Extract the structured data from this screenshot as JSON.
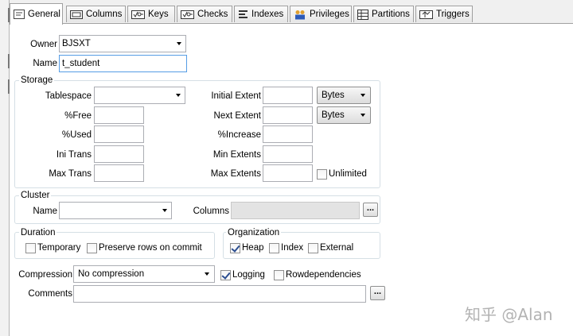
{
  "tabs": [
    {
      "label": "General",
      "icon": "general-tab-icon",
      "active": true
    },
    {
      "label": "Columns",
      "icon": "columns-tab-icon"
    },
    {
      "label": "Keys",
      "icon": "keys-tab-icon"
    },
    {
      "label": "Checks",
      "icon": "checks-tab-icon"
    },
    {
      "label": "Indexes",
      "icon": "indexes-tab-icon"
    },
    {
      "label": "Privileges",
      "icon": "privileges-tab-icon"
    },
    {
      "label": "Partitions",
      "icon": "partitions-tab-icon"
    },
    {
      "label": "Triggers",
      "icon": "triggers-tab-icon"
    }
  ],
  "general": {
    "owner_label": "Owner",
    "owner_value": "BJSXT",
    "name_label": "Name",
    "name_value": "t_student"
  },
  "storage": {
    "title": "Storage",
    "tablespace_label": "Tablespace",
    "tablespace_value": "",
    "free_label": "%Free",
    "used_label": "%Used",
    "ini_trans_label": "Ini Trans",
    "max_trans_label": "Max Trans",
    "initial_extent_label": "Initial Extent",
    "initial_extent_unit": "Bytes",
    "next_extent_label": "Next Extent",
    "next_extent_unit": "Bytes",
    "increase_label": "%Increase",
    "min_extents_label": "Min Extents",
    "max_extents_label": "Max Extents",
    "unlimited_label": "Unlimited",
    "unlimited_checked": false
  },
  "cluster": {
    "title": "Cluster",
    "name_label": "Name",
    "name_value": "",
    "columns_label": "Columns",
    "columns_value": "",
    "browse_label": "..."
  },
  "duration": {
    "title": "Duration",
    "temporary_label": "Temporary",
    "temporary_checked": false,
    "preserve_label": "Preserve rows on commit",
    "preserve_checked": false
  },
  "organization": {
    "title": "Organization",
    "heap_label": "Heap",
    "heap_checked": true,
    "index_label": "Index",
    "index_checked": false,
    "external_label": "External",
    "external_checked": false
  },
  "options": {
    "compression_label": "Compression",
    "compression_value": "No compression",
    "logging_label": "Logging",
    "logging_checked": true,
    "rowdependencies_label": "Rowdependencies",
    "rowdependencies_checked": false
  },
  "comments": {
    "label": "Comments",
    "value": "",
    "browse_label": "..."
  },
  "watermark": "知乎 @Alan"
}
